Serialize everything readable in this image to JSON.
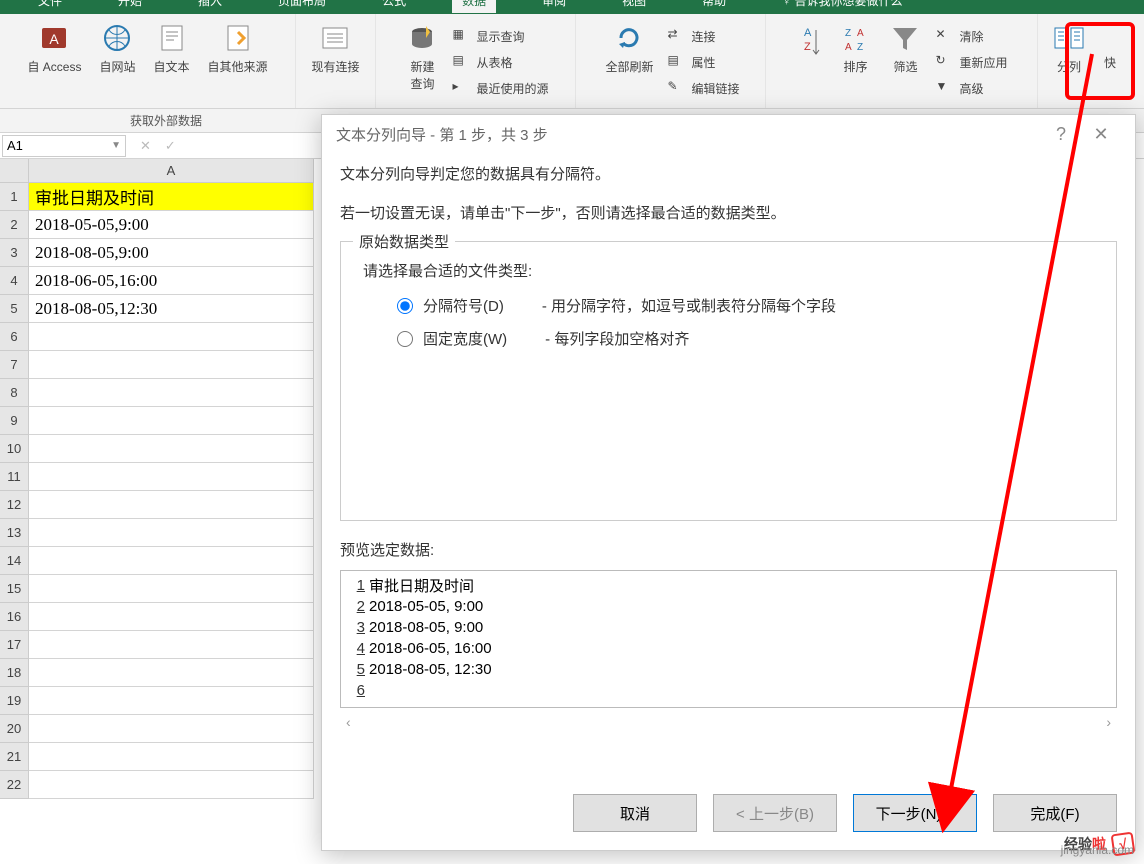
{
  "tabs": {
    "file": "文件",
    "start": "开始",
    "insert": "插入",
    "layout": "页面布局",
    "formula": "公式",
    "data": "数据",
    "review": "审阅",
    "view": "视图",
    "help": "帮助",
    "search": "告诉我你想要做什么"
  },
  "ribbon": {
    "get_data": {
      "access": "自 Access",
      "web": "自网站",
      "text": "自文本",
      "other": "自其他来源",
      "existing": "现有连接",
      "group": "获取外部数据"
    },
    "newquery": {
      "label": "新建\n查询",
      "show": "显示查询",
      "table": "从表格",
      "recent": "最近使用的源"
    },
    "connections": {
      "refresh": "全部刷新",
      "conn": "连接",
      "prop": "属性",
      "edit": "编辑链接"
    },
    "sort": {
      "az": "A",
      "za": "Z",
      "sort": "排序",
      "filter": "筛选",
      "clear": "清除",
      "reapply": "重新应用",
      "advanced": "高级"
    },
    "fenlie": "分列",
    "quick": "快"
  },
  "namebox": "A1",
  "sheet": {
    "col": "A",
    "rows": [
      "审批日期及时间",
      "2018-05-05,9:00",
      "2018-08-05,9:00",
      "2018-06-05,16:00",
      "2018-08-05,12:30"
    ],
    "rownums": [
      "1",
      "2",
      "3",
      "4",
      "5",
      "6",
      "7",
      "8",
      "9",
      "10",
      "11",
      "12",
      "13",
      "14",
      "15",
      "16",
      "17",
      "18",
      "19",
      "20",
      "21",
      "22"
    ]
  },
  "dialog": {
    "title": "文本分列向导 - 第 1 步，共 3 步",
    "help": "?",
    "line1": "文本分列向导判定您的数据具有分隔符。",
    "line2": "若一切设置无误，请单击\"下一步\"，否则请选择最合适的数据类型。",
    "fieldset_title": "原始数据类型",
    "choose": "请选择最合适的文件类型:",
    "radio_delim": "分隔符号(D)",
    "radio_delim_desc": "- 用分隔字符，如逗号或制表符分隔每个字段",
    "radio_fixed": "固定宽度(W)",
    "radio_fixed_desc": "- 每列字段加空格对齐",
    "preview_label": "预览选定数据:",
    "preview": [
      {
        "n": "1",
        "t": "审批日期及时间"
      },
      {
        "n": "2",
        "t": "2018-05-05, 9:00"
      },
      {
        "n": "3",
        "t": "2018-08-05, 9:00"
      },
      {
        "n": "4",
        "t": "2018-06-05, 16:00"
      },
      {
        "n": "5",
        "t": "2018-08-05, 12:30"
      },
      {
        "n": "6",
        "t": ""
      }
    ],
    "btn_cancel": "取消",
    "btn_back": "< 上一步(B)",
    "btn_next": "下一步(N) >",
    "btn_finish": "完成(F)"
  },
  "watermark": {
    "brand1": "经验",
    "brand2": "啦",
    "check": "√",
    "url": "jingyanla.com"
  }
}
